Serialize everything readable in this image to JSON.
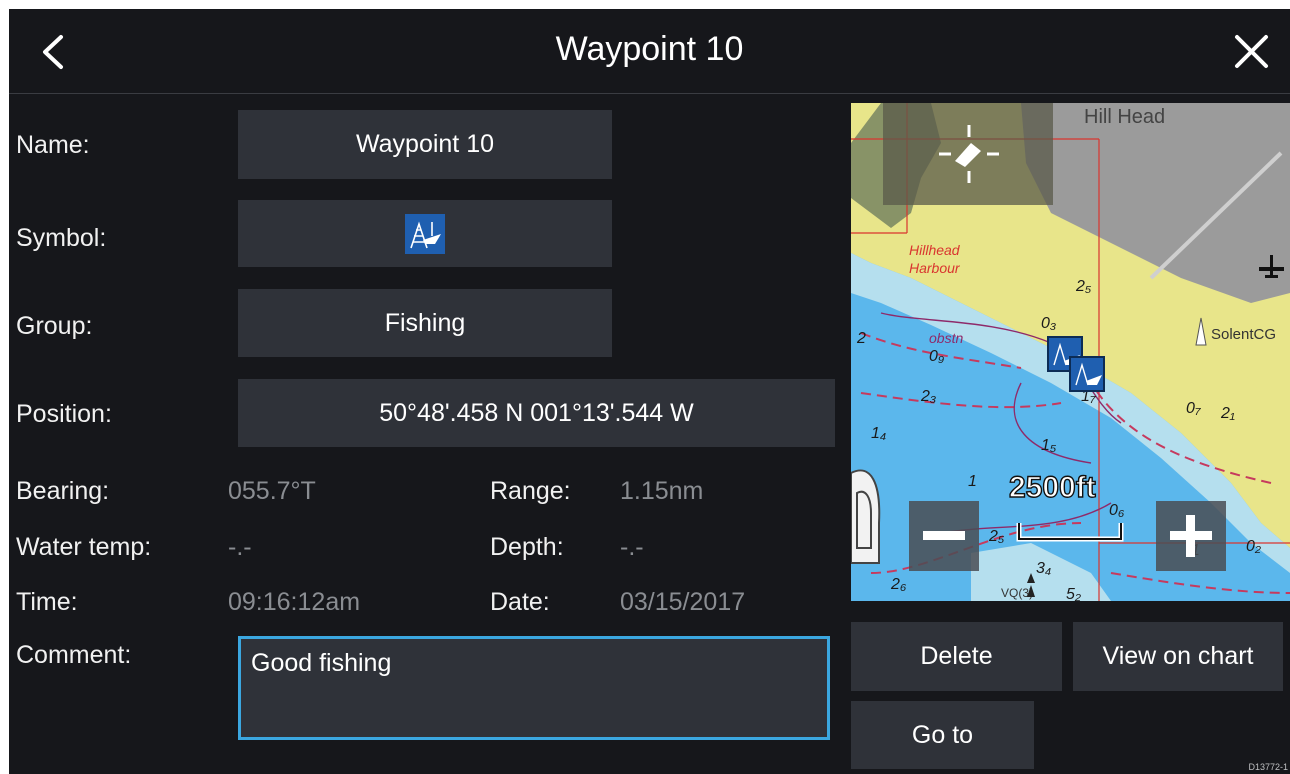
{
  "header": {
    "title": "Waypoint 10",
    "back_icon": "chevron-left-icon",
    "close_icon": "close-icon"
  },
  "form": {
    "name_label": "Name:",
    "name_value": "Waypoint 10",
    "symbol_label": "Symbol:",
    "symbol_icon": "fishing-boat-icon",
    "group_label": "Group:",
    "group_value": "Fishing",
    "position_label": "Position:",
    "position_value": "50°48'.458 N  001°13'.544 W",
    "bearing_label": "Bearing:",
    "bearing_value": "055.7°T",
    "range_label": "Range:",
    "range_value": "1.15nm",
    "water_temp_label": "Water temp:",
    "water_temp_value": "-.-",
    "depth_label": "Depth:",
    "depth_value": "-.-",
    "time_label": "Time:",
    "time_value": "09:16:12am",
    "date_label": "Date:",
    "date_value": "03/15/2017",
    "comment_label": "Comment:",
    "comment_value": "Good fishing"
  },
  "map": {
    "scale_label": "2500ft",
    "zoom_out_icon": "minus-icon",
    "zoom_in_icon": "plus-icon",
    "center_icon": "crosshair-icon",
    "place_labels": [
      "Hill Head",
      "Hillhead",
      "Harbour",
      "SolentCG",
      "obstn",
      "VQ(3)"
    ],
    "depth_soundings": [
      "2₅",
      "0₃",
      "0₉",
      "2₃",
      "1₄",
      "1₅",
      "0₇",
      "2₁",
      "1₇",
      "1",
      "0₆",
      "2₅",
      "3₄",
      "2₆",
      "5₂",
      "0₂",
      "1",
      "2"
    ],
    "colors": {
      "water": "#5bb7ec",
      "shallow": "#b5dfee",
      "land": "#e8e58a",
      "builtup": "#9b9b9b"
    }
  },
  "actions": {
    "delete_label": "Delete",
    "view_on_chart_label": "View on chart",
    "go_to_label": "Go to"
  },
  "figure_code": "D13772-1"
}
